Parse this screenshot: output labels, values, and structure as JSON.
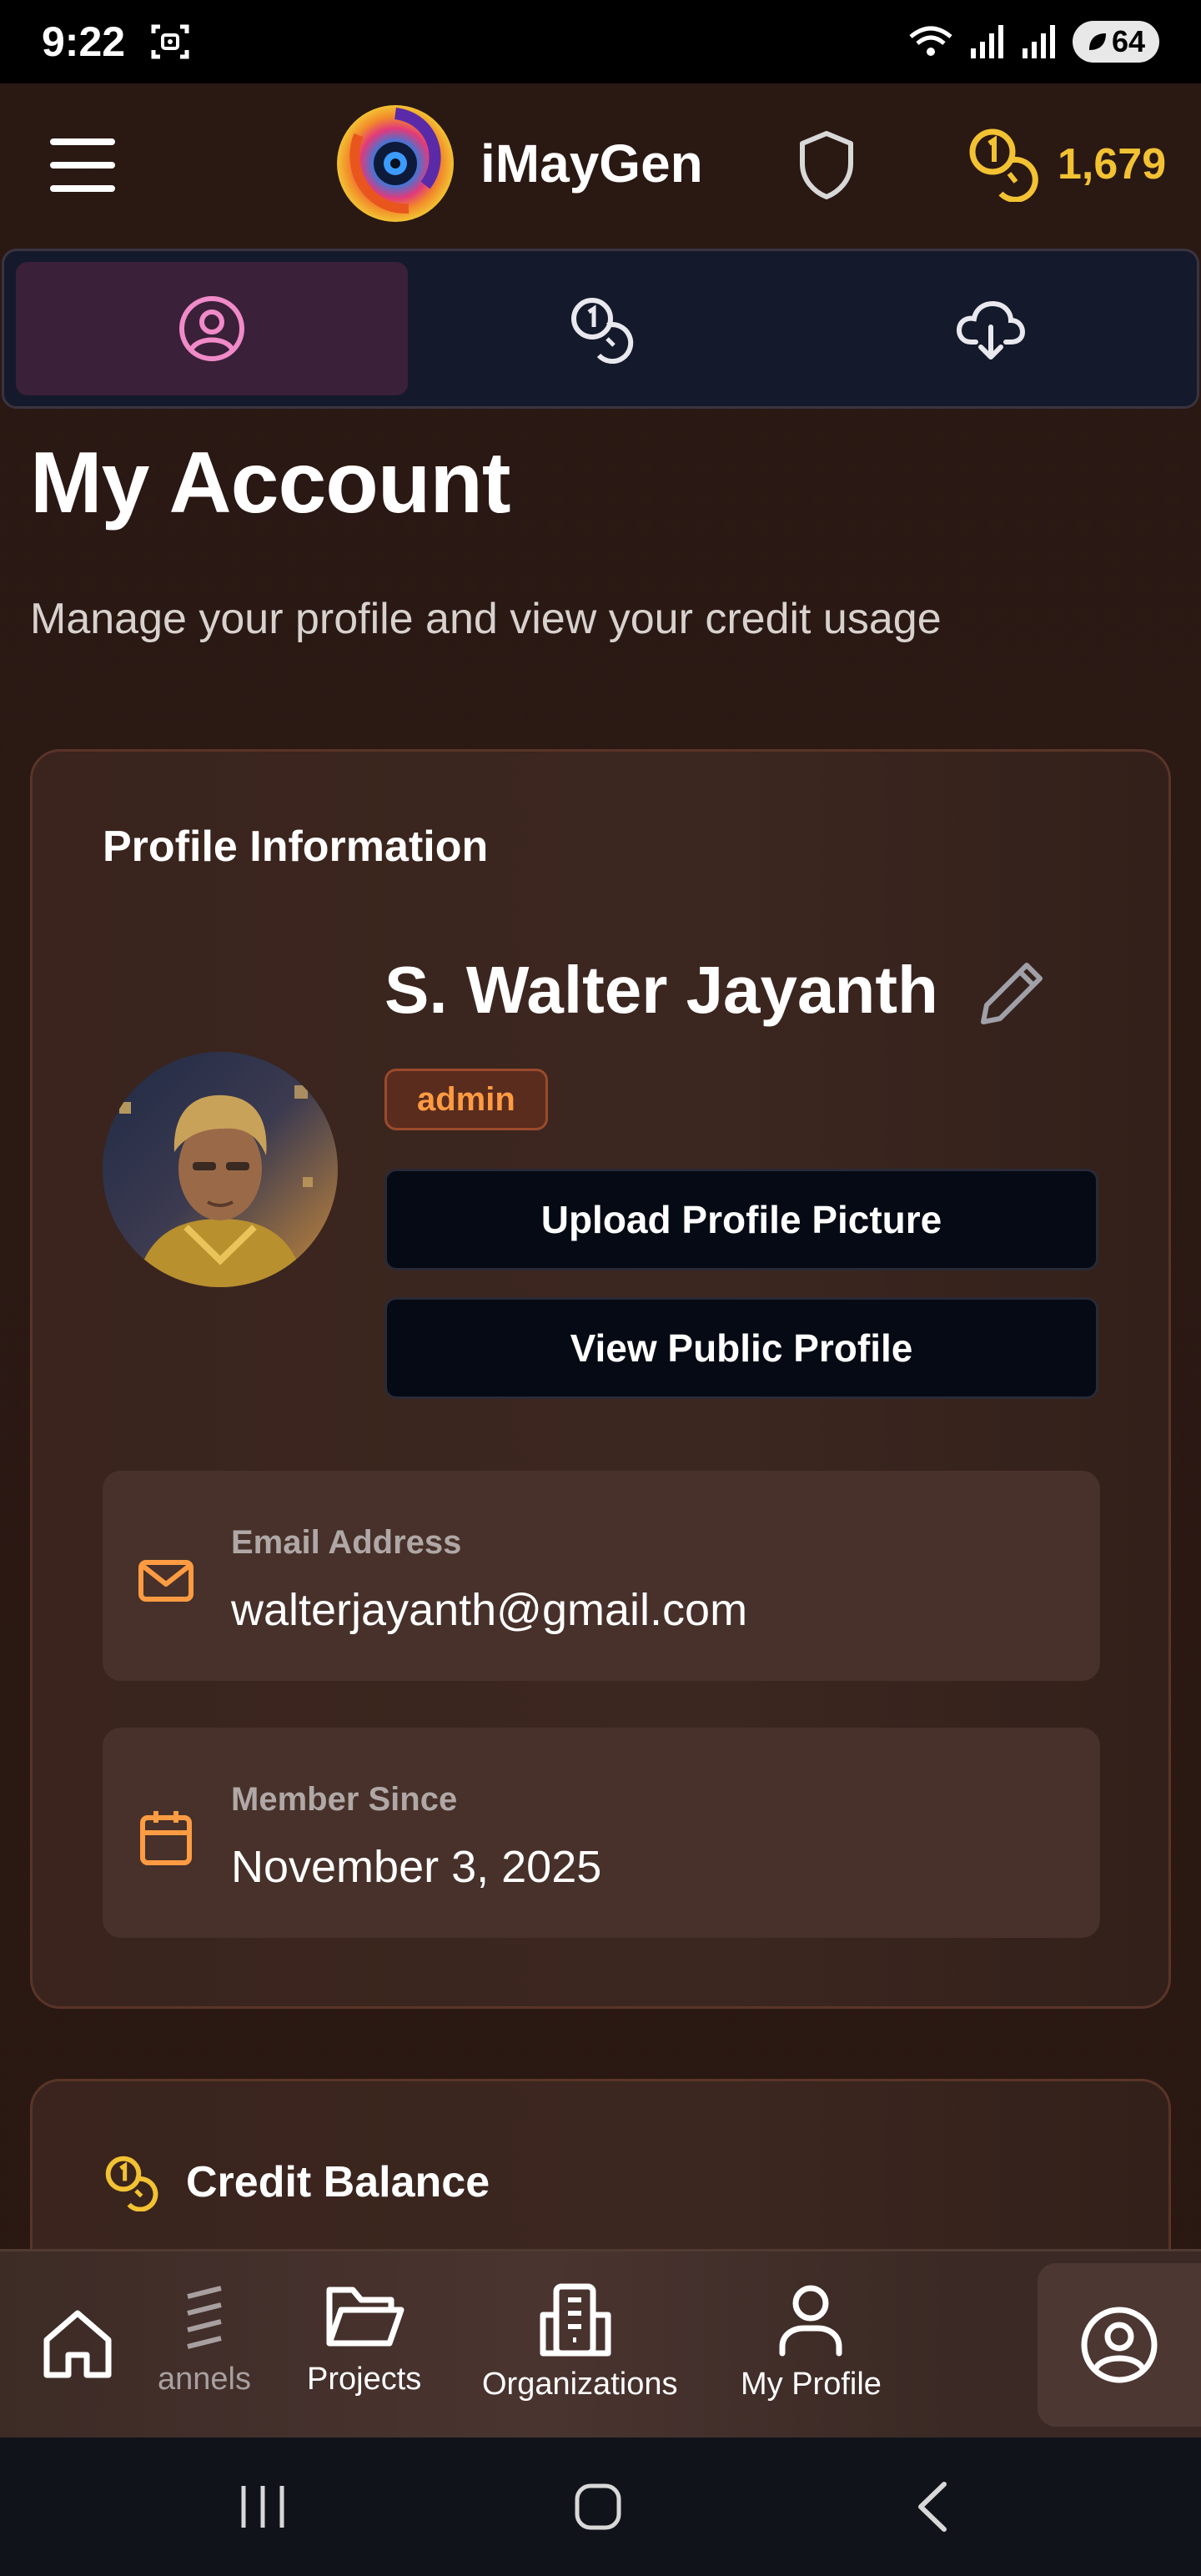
{
  "status_bar": {
    "time": "9:22",
    "battery": "64"
  },
  "header": {
    "brand_name": "iMayGen",
    "credits": "1,679"
  },
  "tabs": [
    {
      "icon": "user-circle-icon",
      "active": true
    },
    {
      "icon": "coins-icon",
      "active": false
    },
    {
      "icon": "cloud-download-icon",
      "active": false
    }
  ],
  "page": {
    "title": "My Account",
    "subtitle": "Manage your profile and view your credit usage"
  },
  "profile": {
    "heading": "Profile Information",
    "name": "S. Walter Jayanth",
    "role": "admin",
    "upload_label": "Upload Profile Picture",
    "public_label": "View Public Profile",
    "email_label": "Email Address",
    "email_value": "walterjayanth@gmail.com",
    "member_label": "Member Since",
    "member_value": "November 3, 2025"
  },
  "credit": {
    "heading": "Credit Balance"
  },
  "bottom_nav": {
    "channels": "annels",
    "projects": "Projects",
    "organizations": "Organizations",
    "my_profile": "My Profile"
  },
  "colors": {
    "accent_orange": "#ff9b42",
    "gold": "#f2c233",
    "tab_active_pink": "#f08ac8"
  }
}
